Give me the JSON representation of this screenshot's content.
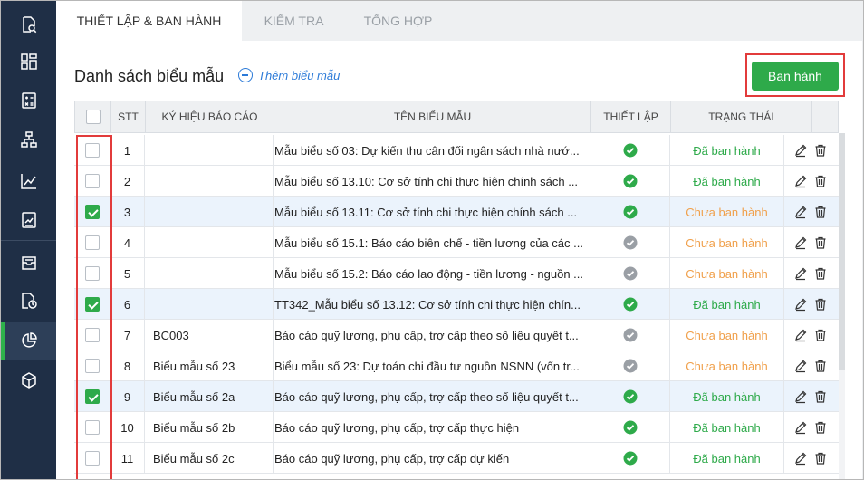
{
  "tabs": [
    {
      "label": "THIẾT LẬP & BAN HÀNH",
      "active": true
    },
    {
      "label": "KIỂM TRA",
      "active": false
    },
    {
      "label": "TỔNG HỢP",
      "active": false
    }
  ],
  "sidebar": {
    "items": [
      {
        "icon": "search-doc-icon"
      },
      {
        "icon": "dashboard-icon"
      },
      {
        "icon": "calculator-icon"
      },
      {
        "icon": "org-chart-icon"
      },
      {
        "icon": "line-chart-icon"
      },
      {
        "icon": "report-icon"
      },
      {
        "icon": "inbox-icon"
      },
      {
        "icon": "doc-clock-icon"
      },
      {
        "icon": "pie-chart-icon",
        "active": true
      },
      {
        "icon": "cube-icon"
      }
    ]
  },
  "main": {
    "title": "Danh sách biểu mẫu",
    "add_label": "Thêm biểu mẫu",
    "publish_label": "Ban hành"
  },
  "colors": {
    "accent": "#2eaa4a",
    "sidebar": "#1f2f46",
    "highlight": "#e23b3b",
    "link": "#2b7ad8",
    "status_published": "#2eaa4a",
    "status_unpublished": "#f0a04b"
  },
  "table": {
    "headers": {
      "stt": "STT",
      "code": "KÝ HIỆU BÁO CÁO",
      "name": "TÊN BIỂU MẪU",
      "setup": "THIẾT LẬP",
      "status": "TRẠNG THÁI"
    },
    "rows": [
      {
        "checked": false,
        "stt": "1",
        "code": "",
        "name": "Mẫu biểu số 03: Dự kiến thu cân đối ngân sách nhà nướ...",
        "setup_done": true,
        "status": "Đã ban hành"
      },
      {
        "checked": false,
        "stt": "2",
        "code": "",
        "name": "Mẫu biểu số 13.10: Cơ sở tính chi thực hiện chính sách ...",
        "setup_done": true,
        "status": "Đã ban hành"
      },
      {
        "checked": true,
        "stt": "3",
        "code": "",
        "name": "Mẫu biểu số 13.11: Cơ sở tính chi thực hiện chính sách ...",
        "setup_done": true,
        "status": "Chưa ban hành"
      },
      {
        "checked": false,
        "stt": "4",
        "code": "",
        "name": "Mẫu biểu số 15.1: Báo cáo biên chế - tiền lương của các ...",
        "setup_done": false,
        "status": "Chưa ban hành"
      },
      {
        "checked": false,
        "stt": "5",
        "code": "",
        "name": "Mẫu biểu số 15.2: Báo cáo lao động - tiền lương - nguồn ...",
        "setup_done": false,
        "status": "Chưa ban hành"
      },
      {
        "checked": true,
        "stt": "6",
        "code": "",
        "name": "TT342_Mẫu biểu số 13.12: Cơ sở tính chi thực hiện chín...",
        "setup_done": true,
        "status": "Đã ban hành"
      },
      {
        "checked": false,
        "stt": "7",
        "code": "BC003",
        "name": "Báo cáo quỹ lương, phụ cấp, trợ cấp theo số liệu quyết t...",
        "setup_done": false,
        "status": "Chưa ban hành"
      },
      {
        "checked": false,
        "stt": "8",
        "code": "Biểu mẫu số 23",
        "name": "Biểu mẫu số 23: Dự toán chi đầu tư nguồn NSNN (vốn tr...",
        "setup_done": false,
        "status": "Chưa ban hành"
      },
      {
        "checked": true,
        "stt": "9",
        "code": "Biểu mẫu số 2a",
        "name": "Báo cáo quỹ lương, phụ cấp, trợ cấp theo số liệu quyết t...",
        "setup_done": true,
        "status": "Đã ban hành"
      },
      {
        "checked": false,
        "stt": "10",
        "code": "Biểu mẫu số 2b",
        "name": "Báo cáo quỹ lương, phụ cấp, trợ cấp thực hiện",
        "setup_done": true,
        "status": "Đã ban hành"
      },
      {
        "checked": false,
        "stt": "11",
        "code": "Biểu mẫu số 2c",
        "name": "Báo cáo quỹ lương, phụ cấp, trợ cấp dự kiến",
        "setup_done": true,
        "status": "Đã ban hành"
      }
    ]
  }
}
